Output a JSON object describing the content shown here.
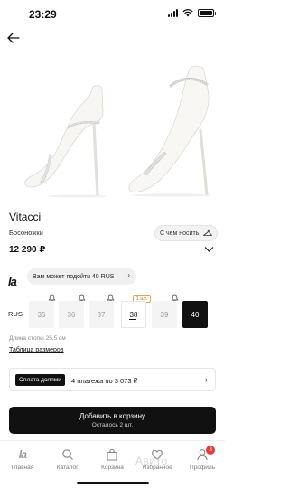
{
  "status_bar": {
    "time": "23:29"
  },
  "header": {
    "back_icon": "arrow-left-icon"
  },
  "gallery": {
    "style_chip_label": "С чем носить",
    "style_chip_icon": "hanger-icon"
  },
  "product": {
    "brand": "Vitacci",
    "category": "Босоножки",
    "price": "12 290 ₽"
  },
  "fit": {
    "logo": "la",
    "recommendation": "Вам может подойти 40 RUS",
    "arrow": "›"
  },
  "sizes": {
    "system": "RUS",
    "options": [
      {
        "size": "35",
        "available": false,
        "notify": true
      },
      {
        "size": "36",
        "available": false,
        "notify": true
      },
      {
        "size": "37",
        "available": false,
        "notify": true
      },
      {
        "size": "38",
        "available": true,
        "badge": "1 шт."
      },
      {
        "size": "39",
        "available": false,
        "notify": true
      },
      {
        "size": "40",
        "available": true,
        "selected": true
      }
    ],
    "foot_length": "Длина стопы 25,5 см",
    "size_table_link": "Таблица размеров"
  },
  "installment": {
    "badge": "Оплата долями",
    "text": "4 платежа по 3 073 ₽",
    "chevron": "›"
  },
  "cart": {
    "label": "Добавить в корзину",
    "sub": "Осталось 2 шт."
  },
  "tab_bar": {
    "items": [
      {
        "label": "Главная",
        "icon": "la-logo-icon"
      },
      {
        "label": "Каталог",
        "icon": "search-icon"
      },
      {
        "label": "Корзина",
        "icon": "bag-icon"
      },
      {
        "label": "Избранное",
        "icon": "heart-icon"
      },
      {
        "label": "Профиль",
        "icon": "person-icon",
        "badge": "3"
      }
    ]
  },
  "watermark": "Авито"
}
